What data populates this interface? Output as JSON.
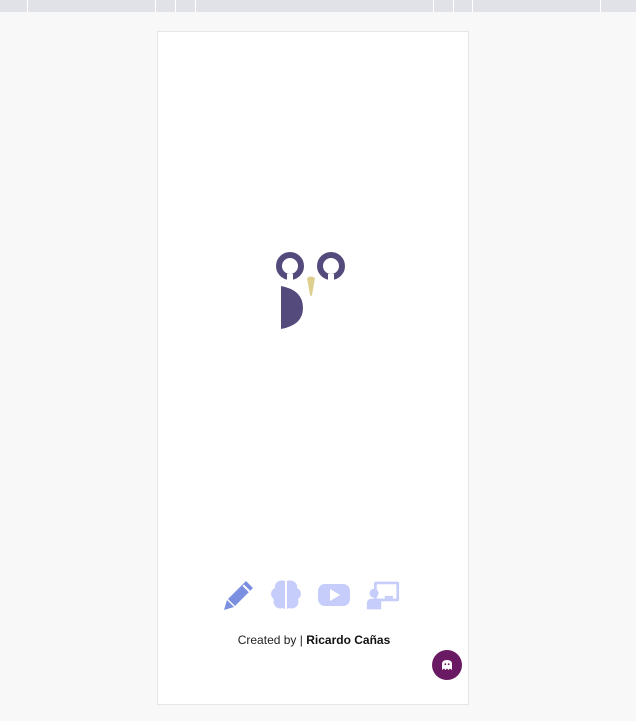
{
  "footer": {
    "created_by_label": "Created by",
    "separator": "|",
    "author_name": "Ricardo Cañas"
  },
  "icons": [
    {
      "name": "pencil-icon",
      "color": "#7a8fe0"
    },
    {
      "name": "brain-icon",
      "color": "#c6cdfa"
    },
    {
      "name": "youtube-play-icon",
      "color": "#c6cdfa"
    },
    {
      "name": "teacher-presentation-icon",
      "color": "#c6cdfa"
    }
  ],
  "colors": {
    "logo_primary": "#544b7c",
    "logo_accent": "#ddd08f",
    "fab_background": "#6a1a63",
    "page_background": "#f8f8f9",
    "top_bar": "#e1e2e8"
  },
  "fab_icon": "ghost-icon"
}
